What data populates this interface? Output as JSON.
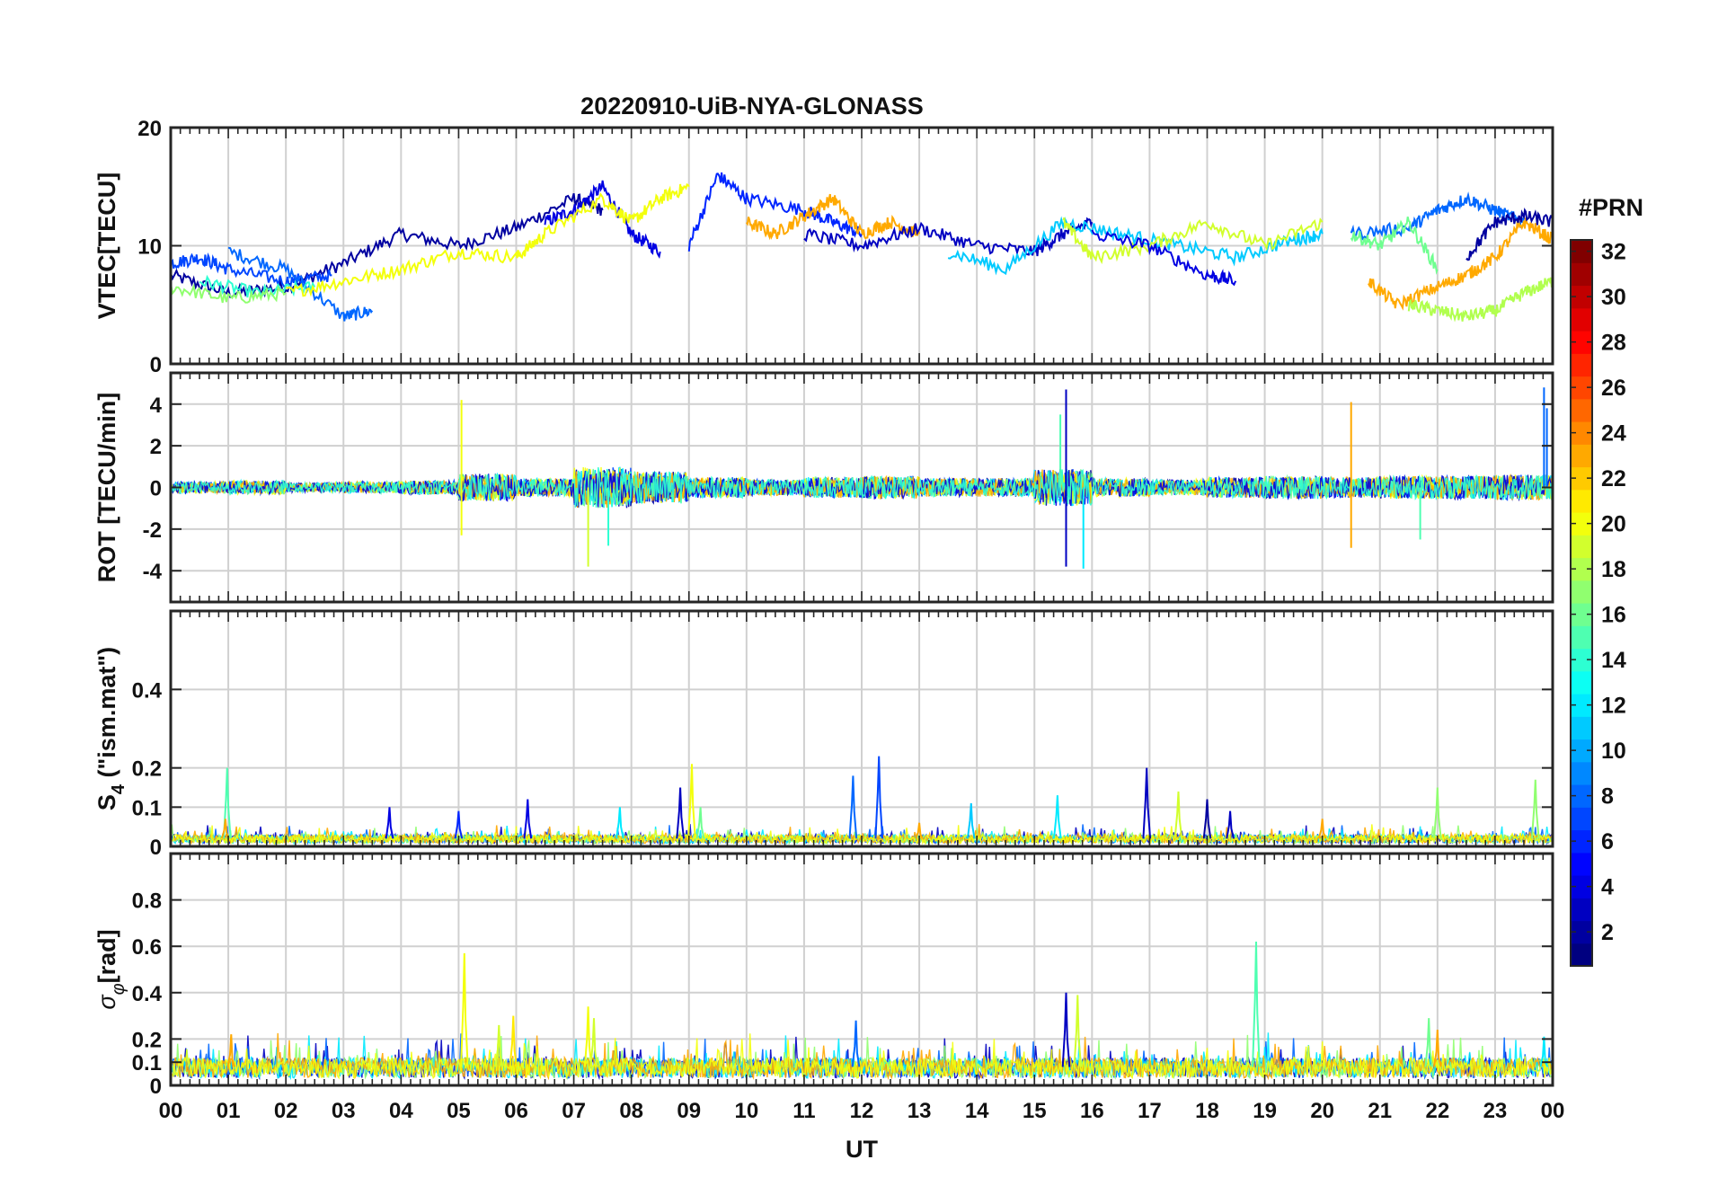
{
  "chart_data": {
    "type": "line",
    "title": "20220910-UiB-NYA-GLONASS",
    "xlabel": "UT",
    "x_ticks": [
      "00",
      "01",
      "02",
      "03",
      "04",
      "05",
      "06",
      "07",
      "08",
      "09",
      "10",
      "11",
      "12",
      "13",
      "14",
      "15",
      "16",
      "17",
      "18",
      "19",
      "20",
      "21",
      "22",
      "23",
      "00"
    ],
    "x_range_hours": [
      0,
      24
    ],
    "grid": true,
    "colorbar": {
      "label": "#PRN",
      "range": [
        1,
        32
      ],
      "ticks": [
        "2",
        "4",
        "6",
        "8",
        "10",
        "12",
        "14",
        "16",
        "18",
        "20",
        "22",
        "24",
        "26",
        "28",
        "30",
        "32"
      ],
      "colormap": "jet",
      "colors": [
        "#00008f",
        "#0000ff",
        "#0080ff",
        "#00ffff",
        "#80ff80",
        "#ffff00",
        "#ff8000",
        "#ff0000",
        "#800000"
      ]
    },
    "panels": [
      {
        "id": "vtec",
        "ylabel": "VTEC[TECU]",
        "ylim": [
          0,
          20
        ],
        "yticks": [
          "0",
          "10",
          "20"
        ],
        "series": [
          {
            "prn": 2,
            "x": [
              0.0,
              1.0,
              2.0,
              3.0,
              4.0,
              5.0,
              6.0,
              7.0,
              7.5
            ],
            "y": [
              7.5,
              6.0,
              6.5,
              8.5,
              11.0,
              10.0,
              11.5,
              14.0,
              13.0
            ]
          },
          {
            "prn": 4,
            "x": [
              6.5,
              7.0,
              7.5,
              8.0,
              8.5
            ],
            "y": [
              12.0,
              13.0,
              15.0,
              11.0,
              9.5
            ]
          },
          {
            "prn": 7,
            "x": [
              0.0,
              0.5,
              1.0,
              2.0,
              2.8
            ],
            "y": [
              8.5,
              9.0,
              8.0,
              7.0,
              7.5
            ]
          },
          {
            "prn": 8,
            "x": [
              1.0,
              2.0,
              3.0,
              3.5
            ],
            "y": [
              9.5,
              8.0,
              4.0,
              4.5
            ]
          },
          {
            "prn": 14,
            "x": [
              0.5,
              1.5,
              2.5
            ],
            "y": [
              7.0,
              6.0,
              6.5
            ]
          },
          {
            "prn": 17,
            "x": [
              0.0,
              1.0,
              2.0
            ],
            "y": [
              6.5,
              5.5,
              6.0
            ]
          },
          {
            "prn": 20,
            "x": [
              2.0,
              3.0,
              4.0,
              5.0,
              6.0,
              6.5,
              7.5,
              8.0,
              8.5,
              9.0
            ],
            "y": [
              6.0,
              7.0,
              8.0,
              9.5,
              9.0,
              11.0,
              14.0,
              12.0,
              14.0,
              15.0
            ]
          },
          {
            "prn": 6,
            "x": [
              9.0,
              9.5,
              10.0,
              11.0,
              11.5,
              12.0
            ],
            "y": [
              10.0,
              16.0,
              14.0,
              13.0,
              12.0,
              11.0
            ]
          },
          {
            "prn": 23,
            "x": [
              10.0,
              10.5,
              11.0,
              11.5,
              12.0,
              12.5,
              13.0
            ],
            "y": [
              12.0,
              11.0,
              12.5,
              14.0,
              11.0,
              12.0,
              11.0
            ]
          },
          {
            "prn": 3,
            "x": [
              11.0,
              12.0,
              13.0,
              14.0,
              15.0,
              15.5,
              16.0
            ],
            "y": [
              11.0,
              10.0,
              11.5,
              10.0,
              9.5,
              11.0,
              12.0
            ]
          },
          {
            "prn": 11,
            "x": [
              13.5,
              14.5,
              15.5,
              16.5,
              17.5,
              18.5,
              19.5,
              20.0
            ],
            "y": [
              9.5,
              8.0,
              12.0,
              11.0,
              10.0,
              9.0,
              10.5,
              11.0
            ]
          },
          {
            "prn": 19,
            "x": [
              15.5,
              16.0,
              17.0,
              18.0,
              19.0,
              20.0
            ],
            "y": [
              12.0,
              9.0,
              10.0,
              12.0,
              10.0,
              12.0
            ]
          },
          {
            "prn": 4,
            "x": [
              16.0,
              17.0,
              18.0,
              18.5
            ],
            "y": [
              11.0,
              10.0,
              7.5,
              7.0
            ]
          },
          {
            "prn": 8,
            "x": [
              20.5,
              21.5,
              22.0,
              22.5,
              23.0,
              23.5
            ],
            "y": [
              11.0,
              11.5,
              13.0,
              14.0,
              13.0,
              12.0
            ]
          },
          {
            "prn": 16,
            "x": [
              20.5,
              21.0,
              21.5,
              22.0
            ],
            "y": [
              11.0,
              10.0,
              12.0,
              8.0
            ]
          },
          {
            "prn": 23,
            "x": [
              20.8,
              21.3,
              22.0,
              22.5,
              23.0,
              23.5,
              24.0
            ],
            "y": [
              7.0,
              5.0,
              6.5,
              7.5,
              9.0,
              12.0,
              10.5
            ]
          },
          {
            "prn": 18,
            "x": [
              21.5,
              22.0,
              22.5,
              23.0,
              23.5,
              24.0
            ],
            "y": [
              5.0,
              4.5,
              4.0,
              4.5,
              6.0,
              7.0
            ]
          },
          {
            "prn": 2,
            "x": [
              22.5,
              23.0,
              23.5,
              24.0
            ],
            "y": [
              9.0,
              12.0,
              12.5,
              12.0
            ]
          }
        ]
      },
      {
        "id": "rot",
        "ylabel": "ROT [TECU/min]",
        "ylim": [
          -5.5,
          5.5
        ],
        "yticks": [
          "-4",
          "-2",
          "0",
          "2",
          "4"
        ],
        "noise_envelope_by_hour": [
          0.5,
          0.6,
          0.4,
          0.5,
          0.6,
          1.2,
          0.8,
          1.8,
          1.4,
          0.9,
          0.7,
          0.9,
          1.0,
          0.8,
          0.8,
          1.6,
          0.8,
          0.7,
          0.9,
          1.0,
          0.9,
          1.0,
          1.0,
          1.1
        ],
        "spikes": [
          {
            "x": 5.05,
            "y": 4.2,
            "prn": 20
          },
          {
            "x": 5.05,
            "y": -2.3,
            "prn": 20
          },
          {
            "x": 7.25,
            "y": -3.8,
            "prn": 19
          },
          {
            "x": 7.6,
            "y": -2.8,
            "prn": 14
          },
          {
            "x": 15.55,
            "y": 4.7,
            "prn": 3
          },
          {
            "x": 15.55,
            "y": -3.8,
            "prn": 3
          },
          {
            "x": 15.85,
            "y": -3.9,
            "prn": 12
          },
          {
            "x": 15.45,
            "y": 3.5,
            "prn": 15
          },
          {
            "x": 20.5,
            "y": 4.1,
            "prn": 23
          },
          {
            "x": 20.5,
            "y": -2.9,
            "prn": 23
          },
          {
            "x": 23.85,
            "y": 4.8,
            "prn": 8
          },
          {
            "x": 23.9,
            "y": 3.8,
            "prn": 8
          },
          {
            "x": 21.7,
            "y": -2.5,
            "prn": 15
          }
        ]
      },
      {
        "id": "s4",
        "ylabel": "S",
        "ylabel_sub": "4",
        "ylabel_suffix": " (\"ism.mat\")",
        "ylim": [
          0,
          0.6
        ],
        "yticks": [
          "0",
          "0.1",
          "0.2",
          "0.4"
        ],
        "baseline": 0.02,
        "peaks": [
          {
            "x": 0.98,
            "y": 0.2,
            "prn": 15
          },
          {
            "x": 0.95,
            "y": 0.07,
            "prn": 23
          },
          {
            "x": 8.85,
            "y": 0.15,
            "prn": 3
          },
          {
            "x": 9.05,
            "y": 0.21,
            "prn": 20
          },
          {
            "x": 9.2,
            "y": 0.1,
            "prn": 16
          },
          {
            "x": 11.85,
            "y": 0.18,
            "prn": 8
          },
          {
            "x": 12.3,
            "y": 0.23,
            "prn": 7
          },
          {
            "x": 15.4,
            "y": 0.13,
            "prn": 12
          },
          {
            "x": 16.95,
            "y": 0.2,
            "prn": 3
          },
          {
            "x": 17.5,
            "y": 0.14,
            "prn": 19
          },
          {
            "x": 18.0,
            "y": 0.12,
            "prn": 2
          },
          {
            "x": 18.4,
            "y": 0.09,
            "prn": 3
          },
          {
            "x": 22.0,
            "y": 0.15,
            "prn": 17
          },
          {
            "x": 23.7,
            "y": 0.17,
            "prn": 17
          },
          {
            "x": 3.8,
            "y": 0.1,
            "prn": 4
          },
          {
            "x": 6.2,
            "y": 0.12,
            "prn": 4
          },
          {
            "x": 5.0,
            "y": 0.09,
            "prn": 6
          },
          {
            "x": 7.8,
            "y": 0.1,
            "prn": 12
          },
          {
            "x": 13.0,
            "y": 0.06,
            "prn": 23
          },
          {
            "x": 13.9,
            "y": 0.11,
            "prn": 11
          },
          {
            "x": 20.0,
            "y": 0.07,
            "prn": 23
          }
        ]
      },
      {
        "id": "sigma",
        "ylabel_symbol": "σ",
        "ylabel_sub": "φ",
        "ylabel_suffix": "[rad]",
        "ylim": [
          0,
          1.0
        ],
        "yticks": [
          "0",
          "0.1",
          "0.2",
          "0.4",
          "0.6",
          "0.8"
        ],
        "baseline": 0.08,
        "peaks": [
          {
            "x": 5.1,
            "y": 0.57,
            "prn": 20
          },
          {
            "x": 5.7,
            "y": 0.26,
            "prn": 19
          },
          {
            "x": 5.95,
            "y": 0.3,
            "prn": 21
          },
          {
            "x": 7.25,
            "y": 0.34,
            "prn": 20
          },
          {
            "x": 7.35,
            "y": 0.29,
            "prn": 19
          },
          {
            "x": 1.05,
            "y": 0.22,
            "prn": 23
          },
          {
            "x": 11.9,
            "y": 0.28,
            "prn": 8
          },
          {
            "x": 15.55,
            "y": 0.4,
            "prn": 3
          },
          {
            "x": 15.75,
            "y": 0.39,
            "prn": 19
          },
          {
            "x": 18.85,
            "y": 0.62,
            "prn": 15
          },
          {
            "x": 21.85,
            "y": 0.29,
            "prn": 16
          },
          {
            "x": 22.0,
            "y": 0.24,
            "prn": 23
          },
          {
            "x": 23.85,
            "y": 0.21,
            "prn": 12
          }
        ]
      }
    ]
  }
}
